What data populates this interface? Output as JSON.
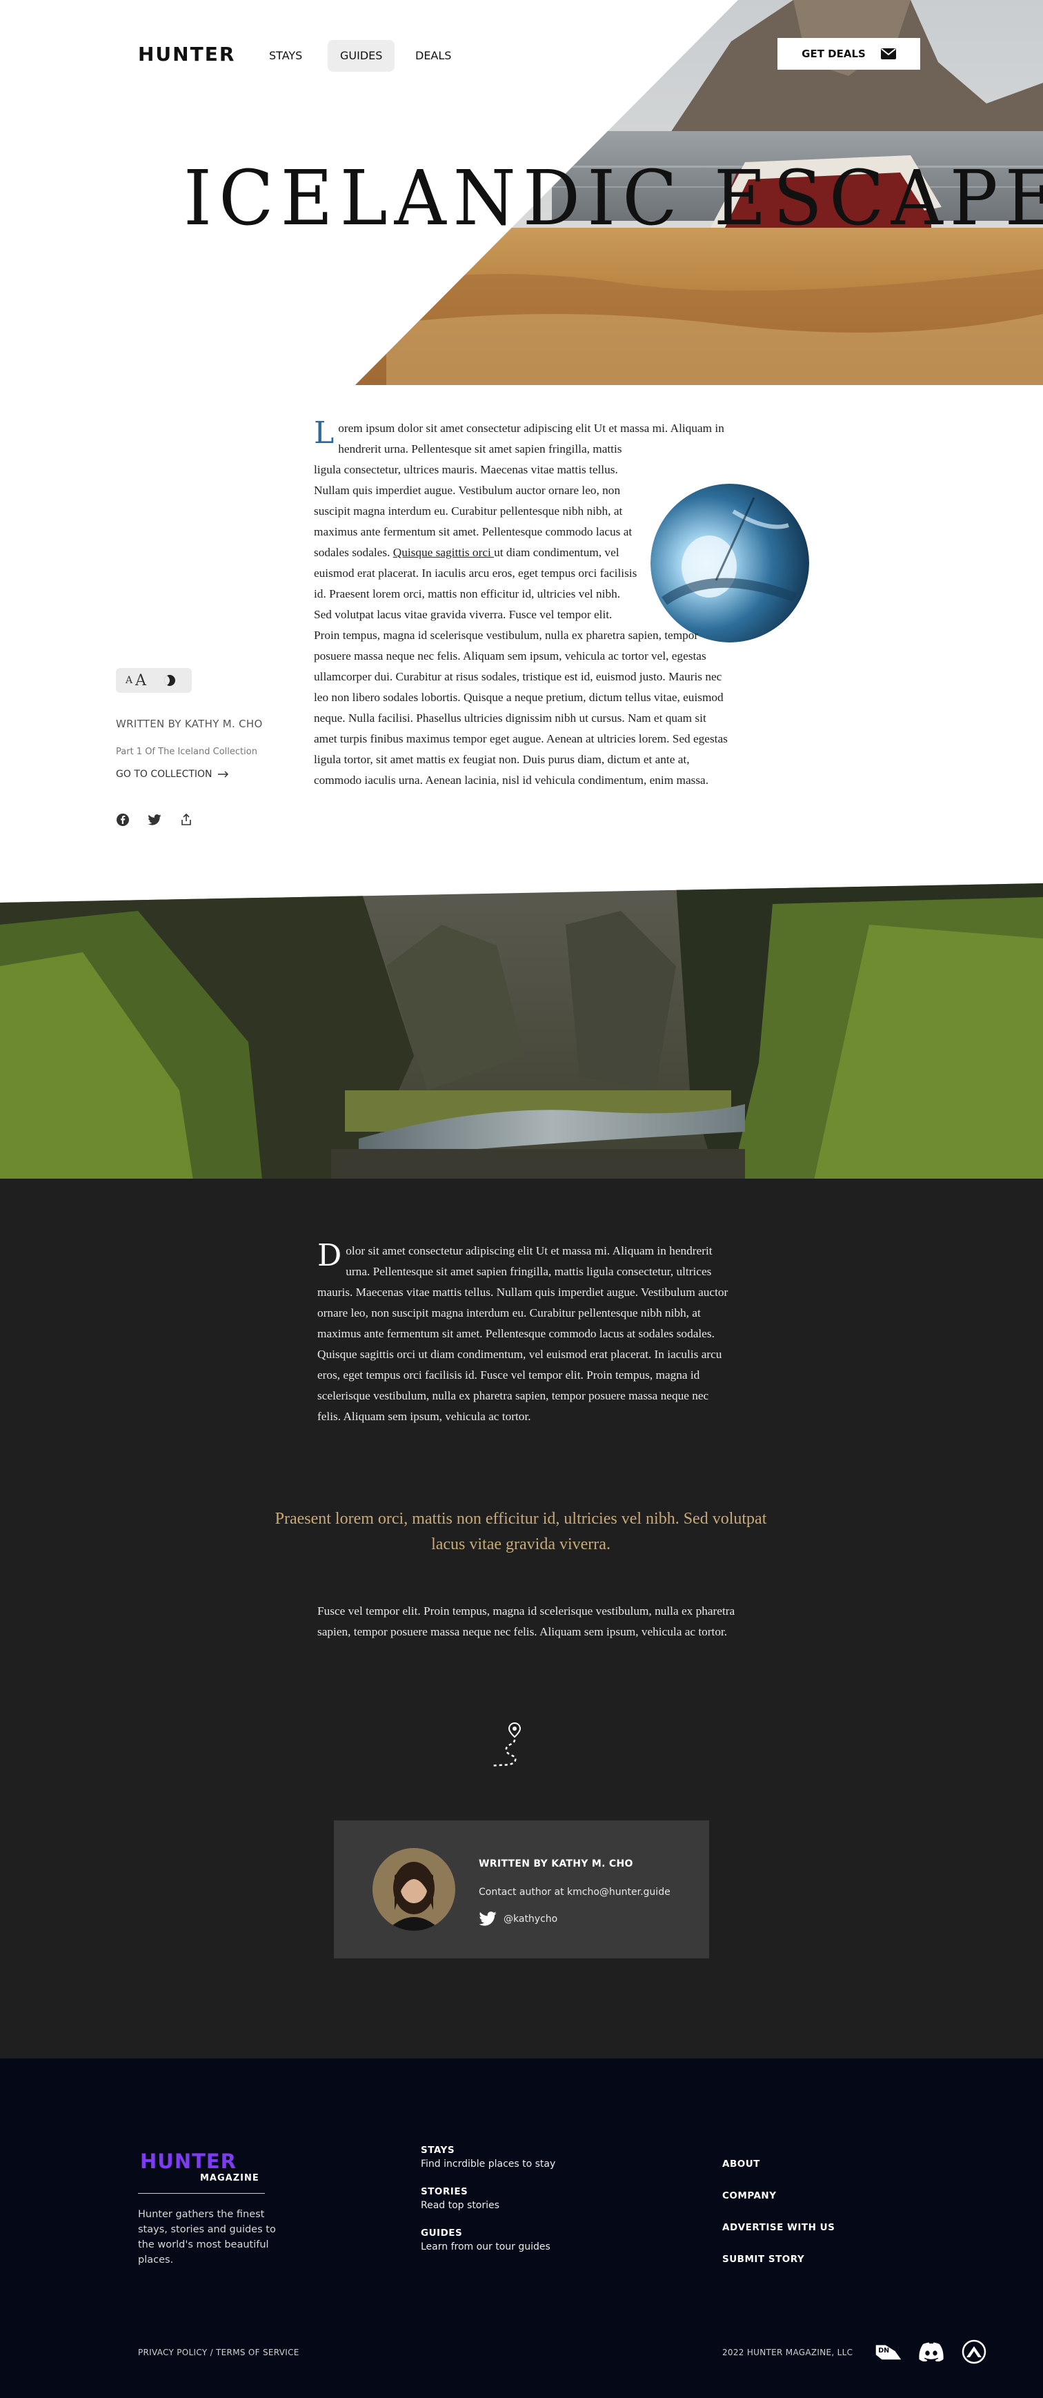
{
  "nav": {
    "logo": "HUNTER",
    "links": [
      {
        "label": "STAYS"
      },
      {
        "label": "GUIDES",
        "active": true
      },
      {
        "label": "DEALS"
      }
    ],
    "cta_label": "GET DEALS",
    "cta_icon": "mail-icon"
  },
  "hero": {
    "title": "ICELANDIC ESCAPE"
  },
  "article": {
    "dropcap": "L",
    "para_before_link": "orem ipsum dolor sit amet consectetur adipiscing elit Ut et massa mi. Aliquam in hendrerit urna. Pellentesque sit amet sapien fringilla, mattis ligula consectetur, ultrices mauris. Maecenas vitae mattis tellus. Nullam quis imperdiet augue. Vestibulum auctor ornare leo, non suscipit magna interdum eu. Curabitur pellentesque nibh nibh, at maximus ante fermentum sit amet. Pellentesque commodo lacus at sodales sodales. ",
    "link_text": "Quisque sagittis orci ",
    "para_after_link": "ut diam condimentum, vel euismod erat placerat. In iaculis arcu eros, eget tempus orci facilisis id. Praesent lorem orci, mattis non efficitur id, ultricies vel nibh. Sed volutpat lacus vitae gravida viverra. Fusce vel tempor elit. Proin tempus, magna id scelerisque vestibulum, nulla ex pharetra sapien, tempor posuere massa neque nec felis. Aliquam sem ipsum, vehicula ac tortor vel, egestas ullamcorper dui. Curabitur at risus sodales, tristique est id, euismod justo. Mauris nec leo non libero sodales lobortis. Quisque a neque pretium, dictum tellus vitae, euismod neque. Nulla facilisi. Phasellus ultricies dignissim nibh ut cursus. Nam et quam sit amet turpis finibus maximus tempor eget augue. Aenean at ultricies lorem. Sed egestas ligula tortor, sit amet mattis ex feugiat non. Duis purus diam, dictum et ante at, commodo iaculis urna. Aenean lacinia, nisl id vehicula condimentum, enim massa."
  },
  "sidebar": {
    "font_small": "A",
    "font_large": "A",
    "author": "WRITTEN BY KATHY M. CHO",
    "part": "Part 1 Of The Iceland Collection",
    "collection_link": "GO TO COLLECTION",
    "share_icons": [
      "facebook-icon",
      "twitter-icon",
      "share-icon"
    ]
  },
  "dark_section": {
    "dropcap": "D",
    "para1": "olor sit amet consectetur adipiscing elit Ut et massa mi. Aliquam in hendrerit urna. Pellentesque sit amet sapien fringilla, mattis ligula consectetur, ultrices mauris. Maecenas vitae mattis tellus. Nullam quis imperdiet augue. Vestibulum auctor ornare leo, non suscipit magna interdum eu. Curabitur pellentesque nibh nibh, at maximus ante fermentum sit amet. Pellentesque commodo lacus at sodales sodales. Quisque sagittis orci ut diam condimentum, vel euismod erat placerat. In iaculis arcu eros, eget tempus orci facilisis id. Fusce vel tempor elit. Proin tempus, magna id scelerisque vestibulum, nulla ex pharetra sapien, tempor posuere massa neque nec felis. Aliquam sem ipsum, vehicula ac tortor.",
    "pullquote": "Praesent lorem orci, mattis non efficitur id, ultricies vel nibh. Sed volutpat lacus vitae gravida viverra.",
    "para2": "Fusce vel tempor elit. Proin tempus, magna id scelerisque vestibulum, nulla ex pharetra sapien, tempor posuere massa neque nec felis. Aliquam sem ipsum, vehicula ac tortor.",
    "route_icon": "route-pin-icon"
  },
  "author_card": {
    "title": "WRITTEN BY KATHY M. CHO",
    "contact": "Contact author at kmcho@hunter.guide",
    "twitter": "@kathycho"
  },
  "footer": {
    "logo": "HUNTER",
    "logo_sub": "MAGAZINE",
    "tagline": "Hunter gathers the finest stays, stories and guides to the world's most beautiful places.",
    "columns": [
      {
        "heading": "STAYS",
        "desc": "Find incrdible places to stay"
      },
      {
        "heading": "STORIES",
        "desc": "Read top stories"
      },
      {
        "heading": "GUIDES",
        "desc": "Learn from our tour guides"
      }
    ],
    "links": [
      "ABOUT",
      "COMPANY",
      "ADVERTISE WITH US",
      "SUBMIT STORY"
    ],
    "legal": "PRIVACY POLICY / TERMS OF SERVICE",
    "copyright": "2022 HUNTER MAGAZINE, LLC",
    "social_icons": [
      "dn-icon",
      "discord-icon",
      "mountain-badge-icon"
    ],
    "colors": {
      "brand": "#7d3cf0",
      "background": "#050816"
    }
  }
}
